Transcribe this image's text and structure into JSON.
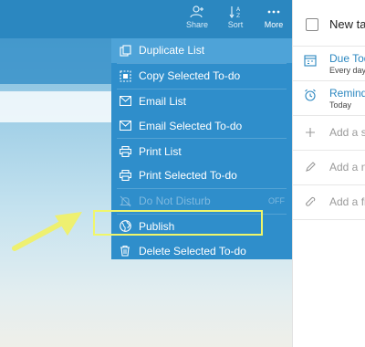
{
  "toolbar": {
    "share_label": "Share",
    "sort_label": "Sort",
    "more_label": "More"
  },
  "menu": {
    "items": [
      {
        "label": "Duplicate List",
        "icon": "duplicate-icon"
      },
      {
        "label": "Copy Selected To-do",
        "icon": "copy-icon"
      },
      {
        "label": "Email List",
        "icon": "email-icon"
      },
      {
        "label": "Email Selected To-do",
        "icon": "email-icon"
      },
      {
        "label": "Print List",
        "icon": "print-icon"
      },
      {
        "label": "Print Selected To-do",
        "icon": "print-icon"
      },
      {
        "label": "Do Not Disturb",
        "icon": "do-not-disturb-icon",
        "badge": "OFF"
      },
      {
        "label": "Publish",
        "icon": "globe-icon"
      },
      {
        "label": "Delete Selected To-do",
        "icon": "trash-icon"
      }
    ]
  },
  "detail": {
    "task_title": "New ta",
    "due": {
      "label": "Due Tod",
      "sub": "Every day"
    },
    "reminder": {
      "label": "Remind",
      "sub": "Today"
    },
    "add_subtask": "Add a su",
    "add_note": "Add a no",
    "add_file": "Add a fil"
  },
  "colors": {
    "toolbar": "#2b87c0",
    "menu": "#2f8ecb",
    "callout": "#f0f66a",
    "accent": "#2b87c0"
  }
}
